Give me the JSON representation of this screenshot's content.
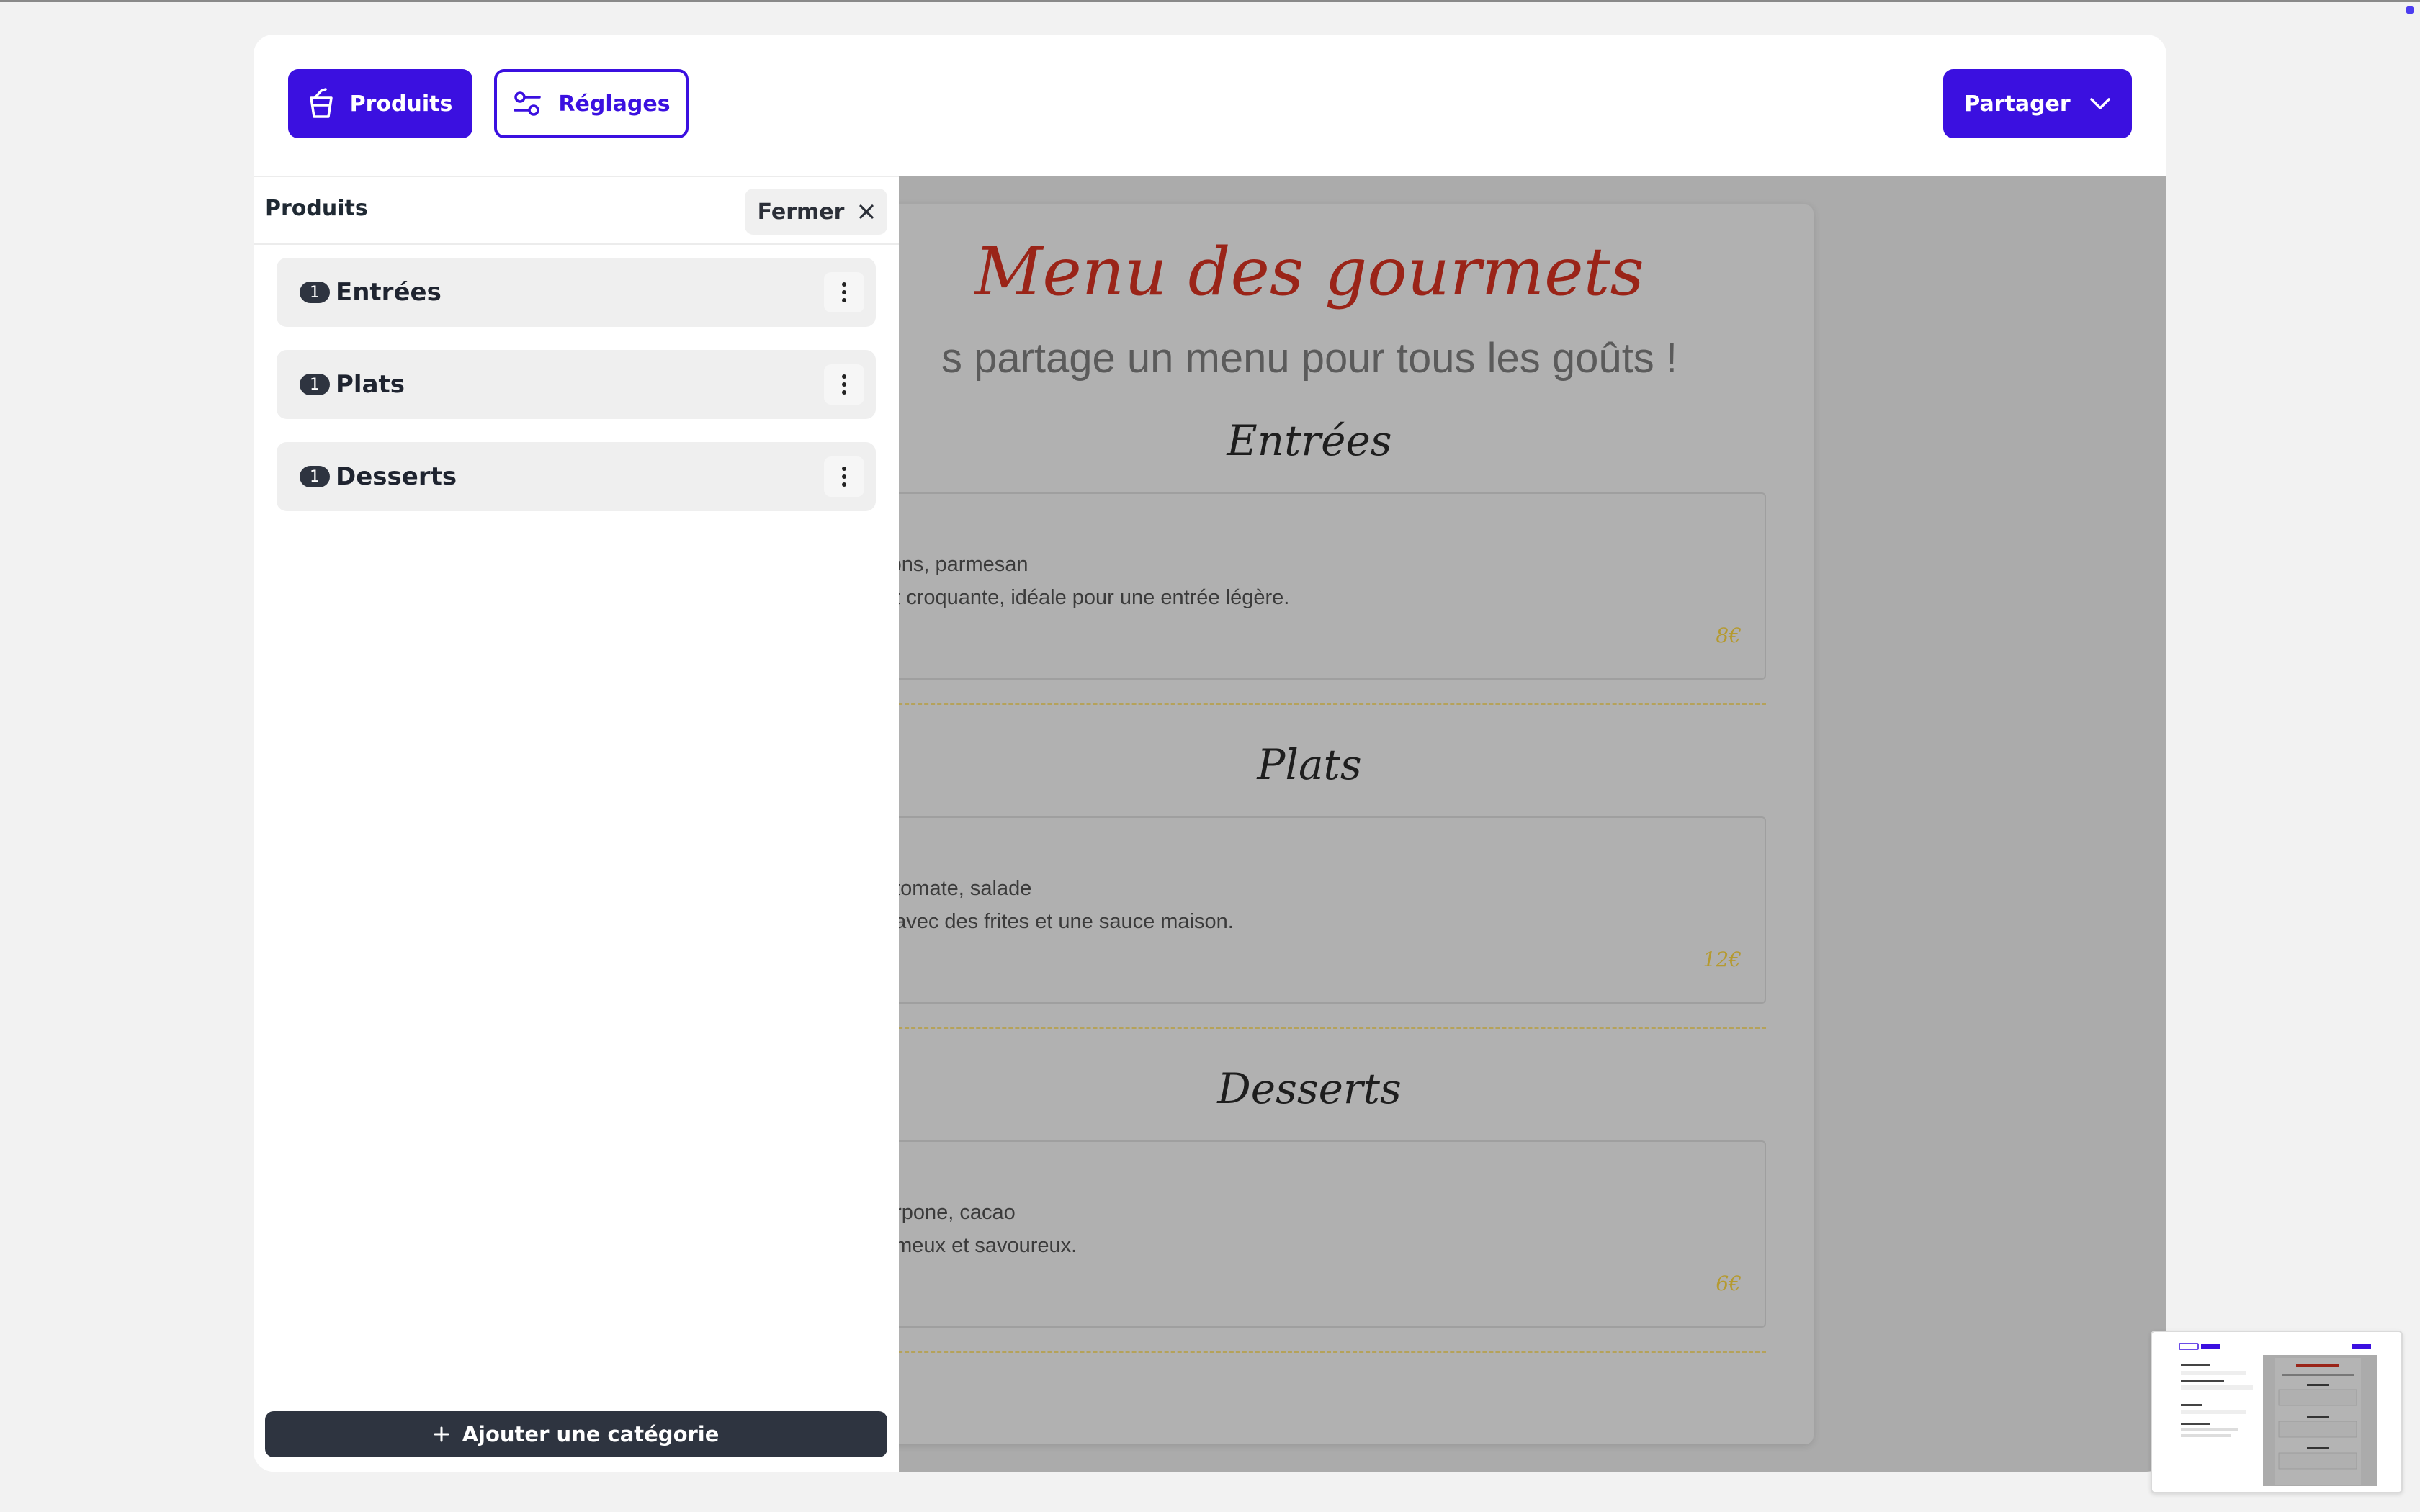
{
  "header": {
    "products_label": "Produits",
    "settings_label": "Réglages",
    "share_label": "Partager"
  },
  "panel": {
    "title": "Produits",
    "close_label": "Fermer",
    "categories": [
      {
        "count": "1",
        "label": "Entrées"
      },
      {
        "count": "1",
        "label": "Plats"
      },
      {
        "count": "1",
        "label": "Desserts"
      }
    ],
    "add_category_label": "Ajouter une catégorie"
  },
  "preview": {
    "title": "Menu des gourmets",
    "subtitle": "s partage un menu pour tous les goûts !",
    "sections": [
      {
        "title": "Entrées",
        "line1": "rons, parmesan",
        "line2": "et croquante, idéale pour une entrée légère.",
        "price": "8€"
      },
      {
        "title": "Plats",
        "line1": ", tomate, salade",
        "line2": ", avec des frites et une sauce maison.",
        "price": "12€"
      },
      {
        "title": "Desserts",
        "line1": "arpone, cacao",
        "line2": "émeux et savoureux.",
        "price": "6€"
      }
    ]
  },
  "icons": {
    "products": "cup-icon",
    "settings": "sliders-icon",
    "share": "chevron-down-icon",
    "close": "close-icon",
    "more": "kebab-icon",
    "add": "plus-icon"
  },
  "colors": {
    "accent": "#3b10e0",
    "dark": "#2e3440",
    "menu_title": "#9a2418",
    "price": "#b59a30"
  }
}
